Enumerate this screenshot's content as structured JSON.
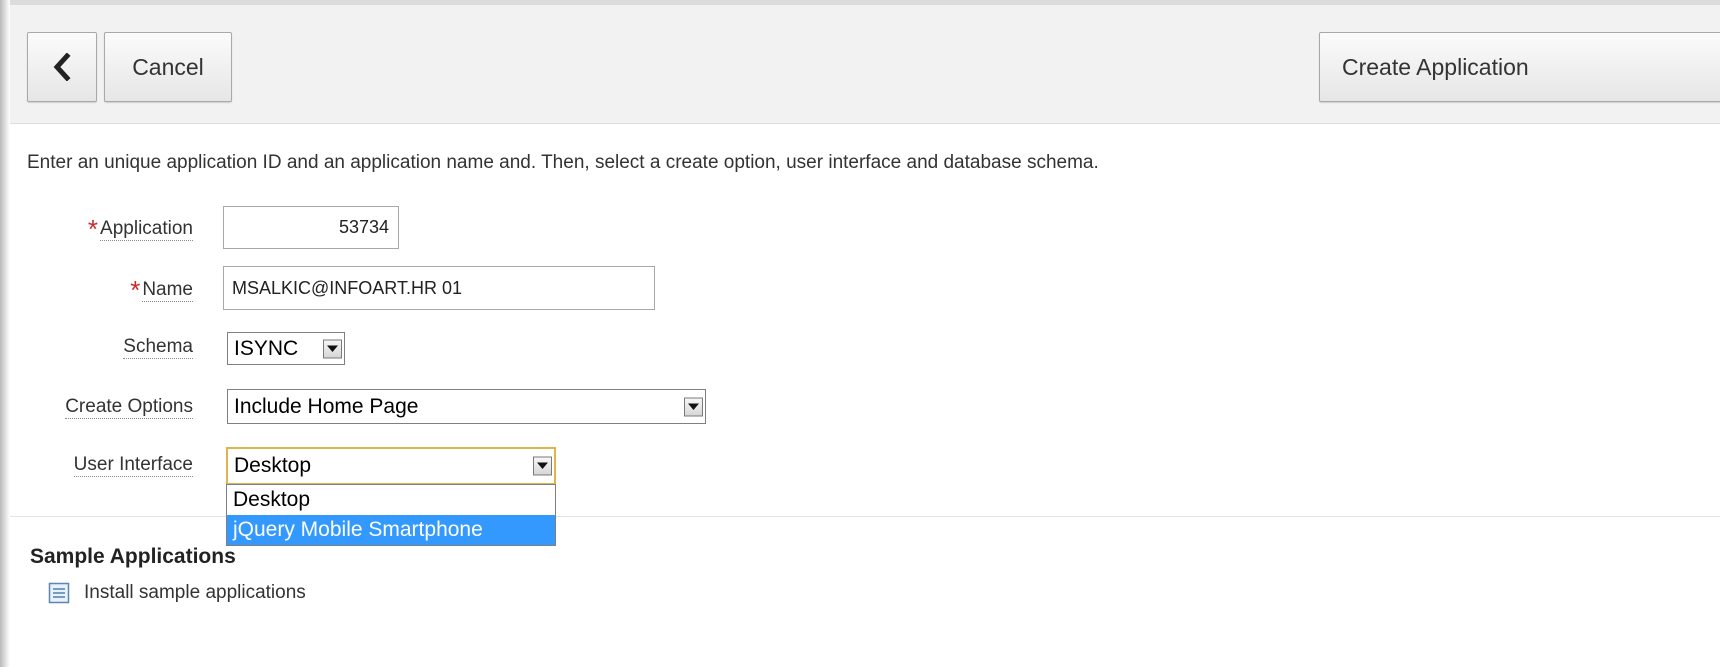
{
  "toolbar": {
    "back_icon": "chevron-left-icon",
    "cancel_label": "Cancel",
    "create_label": "Create Application"
  },
  "instructions": "Enter an unique application ID and an application name and. Then, select a create option, user interface and database schema.",
  "form": {
    "application": {
      "label": "Application",
      "required": true,
      "value": "53734"
    },
    "name": {
      "label": "Name",
      "required": true,
      "value": "MSALKIC@INFOART.HR 01"
    },
    "schema": {
      "label": "Schema",
      "value": "ISYNC"
    },
    "create_options": {
      "label": "Create Options",
      "value": "Include Home Page"
    },
    "user_interface": {
      "label": "User Interface",
      "value": "Desktop",
      "options": [
        "Desktop",
        "jQuery Mobile Smartphone"
      ],
      "highlighted_option": "jQuery Mobile Smartphone"
    }
  },
  "sample_apps": {
    "title": "Sample Applications",
    "link": "Install sample applications",
    "icon": "document-list-icon"
  },
  "colors": {
    "required": "#cc2a2a",
    "selection": "#3399ff",
    "focus_border": "#e0b44c"
  }
}
